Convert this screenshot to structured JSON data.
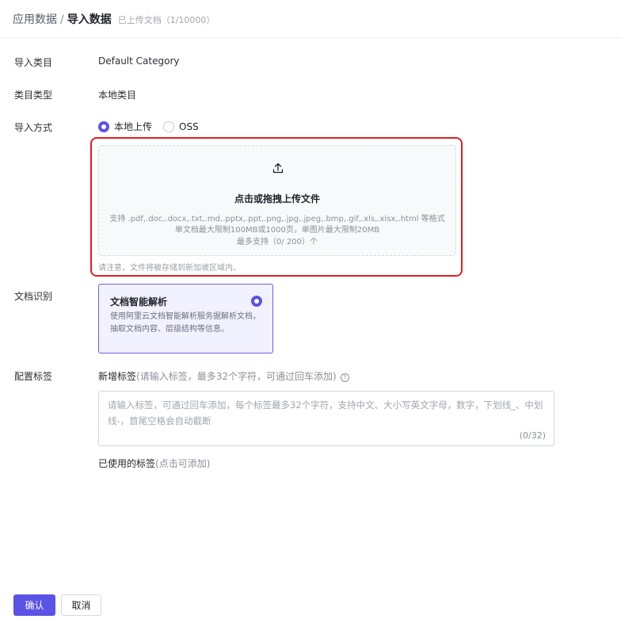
{
  "header": {
    "breadcrumb_parent": "应用数据",
    "breadcrumb_sep": "/",
    "breadcrumb_current": "导入数据",
    "upload_count": "已上传文档（1/10000）"
  },
  "form": {
    "category_label": "导入类目",
    "category_value": "Default Category",
    "type_label": "类目类型",
    "type_value": "本地类目",
    "method_label": "导入方式",
    "method_options": [
      "本地上传",
      "OSS"
    ],
    "method_selected": "本地上传",
    "upload": {
      "title": "点击或拖拽上传文件",
      "formats": "支持 .pdf,.doc,.docx,.txt,.md,.pptx,.ppt,.png,.jpg,.jpeg,.bmp,.gif,.xls,.xlsx,.html 等格式",
      "limits": "单文档最大限制100MB或1000页，单图片最大限制20MB",
      "max_files": "最多支持（0/ 200）个",
      "note": "请注意，文件将被存储到新加坡区域内。"
    },
    "recognition_label": "文档识别",
    "recognition_card": {
      "title": "文档智能解析",
      "description": "使用阿里云文档智能解析服务据解析文档，抽取文档内容、层级结构等信息。"
    },
    "tags_label": "配置标签",
    "tags": {
      "new_tag_label": "新增标签",
      "new_tag_hint": "(请输入标签，最多32个字符，可通过回车添加)",
      "help_icon": "question-circle-icon",
      "placeholder": "请输入标签，可通过回车添加，每个标签最多32个字符，支持中文、大小写英文字母，数字，下划线_、中划线-，首尾空格会自动截断",
      "counter": "(0/32)",
      "used_label": "已使用的标签",
      "used_hint": "(点击可添加)"
    }
  },
  "footer": {
    "confirm_label": "确认",
    "cancel_label": "取消"
  },
  "colors": {
    "primary": "#5b53e5",
    "highlight_frame": "#e02020"
  }
}
